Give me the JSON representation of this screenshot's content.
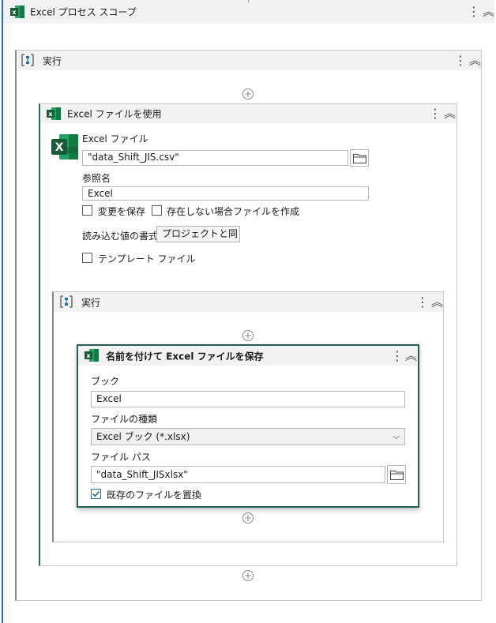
{
  "process_scope": {
    "title": "Excel プロセス スコープ"
  },
  "outer_do": {
    "title": "実行"
  },
  "use_excel": {
    "title": "Excel ファイルを使用",
    "file_label": "Excel ファイル",
    "file_value": "\"data_Shift_JIS.csv\"",
    "ref_label": "参照名",
    "ref_value": "Excel",
    "save_changes_label": "変更を保存",
    "create_if_not_exists_label": "存在しない場合ファイルを作成",
    "read_format_label": "読み込む値の書式",
    "read_format_value": "プロジェクトと同じ",
    "template_label": "テンプレート ファイル"
  },
  "inner_do": {
    "title": "実行"
  },
  "save_as": {
    "title": "名前を付けて Excel ファイルを保存",
    "book_label": "ブック",
    "book_value": "Excel",
    "type_label": "ファイルの種類",
    "type_value": "Excel ブック (*.xlsx)",
    "path_label": "ファイル パス",
    "path_value": "\"data_Shift_JISxlsx\"",
    "replace_label": "既存のファイルを置換",
    "replace_checked": true
  },
  "icons": [
    "excel-icon",
    "sequence-icon",
    "kebab-menu-icon",
    "collapse-chevron-icon",
    "add-activity-icon",
    "folder-icon",
    "dropdown-chevron-icon",
    "checkmark-icon"
  ],
  "colors": {
    "excel_green": "#1d6f42",
    "selection_border": "#1f5e52",
    "left_accent": "#1f6fb5",
    "check_blue": "#1f6fb5"
  }
}
